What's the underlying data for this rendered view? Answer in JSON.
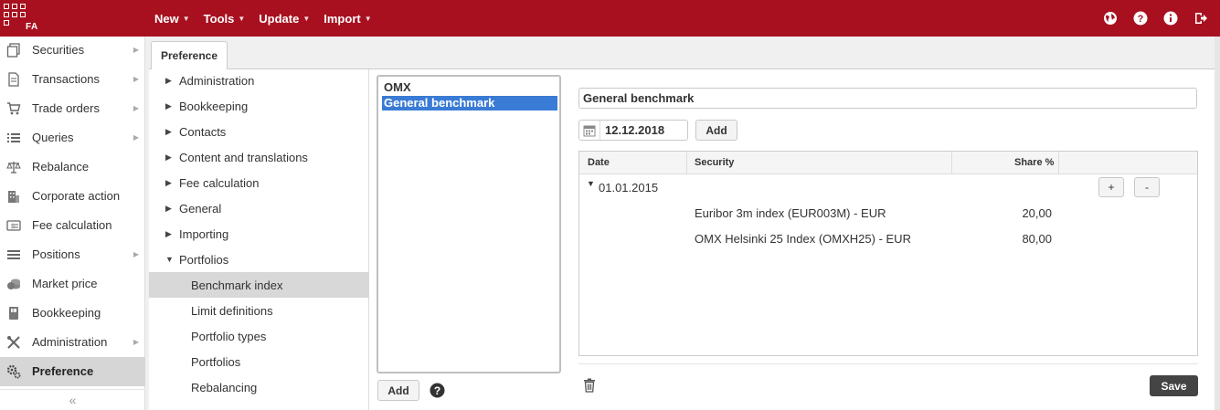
{
  "app": {
    "logo_text": "FA"
  },
  "topmenu": [
    {
      "label": "New"
    },
    {
      "label": "Tools"
    },
    {
      "label": "Update"
    },
    {
      "label": "Import"
    }
  ],
  "top_icons": [
    "globe-icon",
    "help-icon",
    "info-icon",
    "logout-icon"
  ],
  "sidebar": {
    "items": [
      {
        "label": "Securities",
        "icon": "securities-icon",
        "has_arrow": true
      },
      {
        "label": "Transactions",
        "icon": "transactions-icon",
        "has_arrow": true
      },
      {
        "label": "Trade orders",
        "icon": "cart-icon",
        "has_arrow": true
      },
      {
        "label": "Queries",
        "icon": "list-icon",
        "has_arrow": true
      },
      {
        "label": "Rebalance",
        "icon": "scale-icon",
        "has_arrow": false
      },
      {
        "label": "Corporate action",
        "icon": "building-icon",
        "has_arrow": false
      },
      {
        "label": "Fee calculation",
        "icon": "fee-icon",
        "has_arrow": false
      },
      {
        "label": "Positions",
        "icon": "positions-icon",
        "has_arrow": true
      },
      {
        "label": "Market price",
        "icon": "coins-icon",
        "has_arrow": false
      },
      {
        "label": "Bookkeeping",
        "icon": "book-icon",
        "has_arrow": false
      },
      {
        "label": "Administration",
        "icon": "tools-icon",
        "has_arrow": true
      },
      {
        "label": "Preference",
        "icon": "gears-icon",
        "has_arrow": false,
        "active": true
      }
    ],
    "collapse_label": "«"
  },
  "tab": {
    "label": "Preference"
  },
  "tree": [
    {
      "label": "Administration",
      "expanded": false
    },
    {
      "label": "Bookkeeping",
      "expanded": false
    },
    {
      "label": "Contacts",
      "expanded": false
    },
    {
      "label": "Content and translations",
      "expanded": false
    },
    {
      "label": "Fee calculation",
      "expanded": false
    },
    {
      "label": "General",
      "expanded": false
    },
    {
      "label": "Importing",
      "expanded": false
    },
    {
      "label": "Portfolios",
      "expanded": true
    },
    {
      "label": "Benchmark index",
      "child": true,
      "selected": true
    },
    {
      "label": "Limit definitions",
      "child": true
    },
    {
      "label": "Portfolio types",
      "child": true
    },
    {
      "label": "Portfolios",
      "child": true
    },
    {
      "label": "Rebalancing",
      "child": true
    }
  ],
  "benchmarks": {
    "items": [
      "OMX",
      "General benchmark"
    ],
    "selected": "General benchmark",
    "add_label": "Add"
  },
  "detail": {
    "name_value": "General benchmark",
    "date_value": "12.12.2018",
    "add_label": "Add",
    "grid": {
      "headers": {
        "date": "Date",
        "security": "Security",
        "share": "Share %"
      },
      "group_date": "01.01.2015",
      "plus_label": "+",
      "minus_label": "-",
      "rows": [
        {
          "security": "Euribor 3m index (EUR003M) - EUR",
          "share": "20,00"
        },
        {
          "security": "OMX Helsinki 25 Index (OMXH25) - EUR",
          "share": "80,00"
        }
      ]
    },
    "save_label": "Save"
  }
}
